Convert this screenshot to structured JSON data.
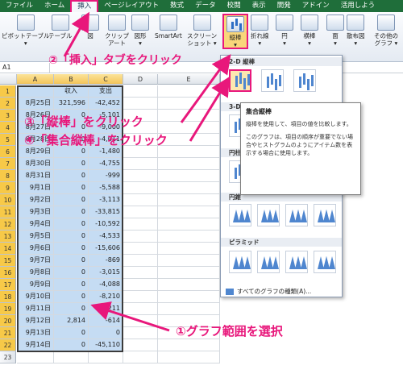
{
  "ribbon": {
    "tabs": [
      "ファイル",
      "ホーム",
      "挿入",
      "ページレイアウト",
      "数式",
      "データ",
      "校閲",
      "表示",
      "開発",
      "アドイン",
      "活用しよう"
    ],
    "buttons": [
      {
        "label": "ピボットテーブル",
        "sub": "▾"
      },
      {
        "label": "テーブル",
        "sub": ""
      },
      {
        "label": "図",
        "sub": ""
      },
      {
        "label": "クリップ",
        "sub": "アート"
      },
      {
        "label": "図形",
        "sub": "▾"
      },
      {
        "label": "SmartArt",
        "sub": ""
      },
      {
        "label": "スクリーン",
        "sub": "ショット ▾"
      },
      {
        "label": "縦棒",
        "sub": "▾"
      },
      {
        "label": "折れ線",
        "sub": "▾"
      },
      {
        "label": "円",
        "sub": "▾"
      },
      {
        "label": "横棒",
        "sub": "▾"
      },
      {
        "label": "面",
        "sub": "▾"
      },
      {
        "label": "散布図",
        "sub": "▾"
      },
      {
        "label": "その他の",
        "sub": "グラフ ▾"
      }
    ]
  },
  "formula_bar": {
    "name_box": "A1"
  },
  "columns": [
    "A",
    "B",
    "C",
    "D",
    "E"
  ],
  "table": {
    "headers": [
      "",
      "収入",
      "支出"
    ],
    "rows": [
      [
        "8月25日",
        "321,596",
        "-42,452"
      ],
      [
        "8月26日",
        "0",
        "-5,101"
      ],
      [
        "8月27日",
        "0",
        "-9,000"
      ],
      [
        "8月28日",
        "0",
        "-4,011"
      ],
      [
        "8月29日",
        "0",
        "-1,480"
      ],
      [
        "8月30日",
        "0",
        "-4,755"
      ],
      [
        "8月31日",
        "0",
        "-999"
      ],
      [
        "9月1日",
        "0",
        "-5,588"
      ],
      [
        "9月2日",
        "0",
        "-3,113"
      ],
      [
        "9月3日",
        "0",
        "-33,815"
      ],
      [
        "9月4日",
        "0",
        "-10,592"
      ],
      [
        "9月5日",
        "0",
        "-4,533"
      ],
      [
        "9月6日",
        "0",
        "-15,606"
      ],
      [
        "9月7日",
        "0",
        "-869"
      ],
      [
        "9月8日",
        "0",
        "-3,015"
      ],
      [
        "9月9日",
        "0",
        "-4,088"
      ],
      [
        "9月10日",
        "0",
        "-8,210"
      ],
      [
        "9月11日",
        "0",
        "-2,211"
      ],
      [
        "9月12日",
        "2,814",
        "-614"
      ],
      [
        "9月13日",
        "0",
        "0"
      ],
      [
        "9月14日",
        "0",
        "-45,110"
      ]
    ],
    "row_numbers": [
      "1",
      "2",
      "3",
      "4",
      "5",
      "6",
      "7",
      "8",
      "9",
      "10",
      "11",
      "12",
      "13",
      "14",
      "15",
      "16",
      "17",
      "18",
      "19",
      "20",
      "21",
      "22",
      "23"
    ]
  },
  "dropdown": {
    "sections": [
      "2-D 縦棒",
      "3-D",
      "円柱",
      "円錐",
      "ピラミッド"
    ],
    "footer": "すべてのグラフの種類(A)..."
  },
  "tooltip": {
    "title": "集合縦棒",
    "body1": "縦棒を使用して、項目の値を比較します。",
    "body2": "このグラフは、項目の順序が重要でない場合やヒストグラムのようにアイテム数を表示する場合に使用します。"
  },
  "annotations": {
    "step1": "①グラフ範囲を選択",
    "step2": "②「挿入」タブをクリック",
    "step3": "③「縦棒」をクリック",
    "step4": "④「集合縦棒」をクリック"
  },
  "colors": {
    "accent": "#e8177b",
    "selection": "#c5dcf3",
    "ribbon_tab": "#1f6e3a"
  }
}
